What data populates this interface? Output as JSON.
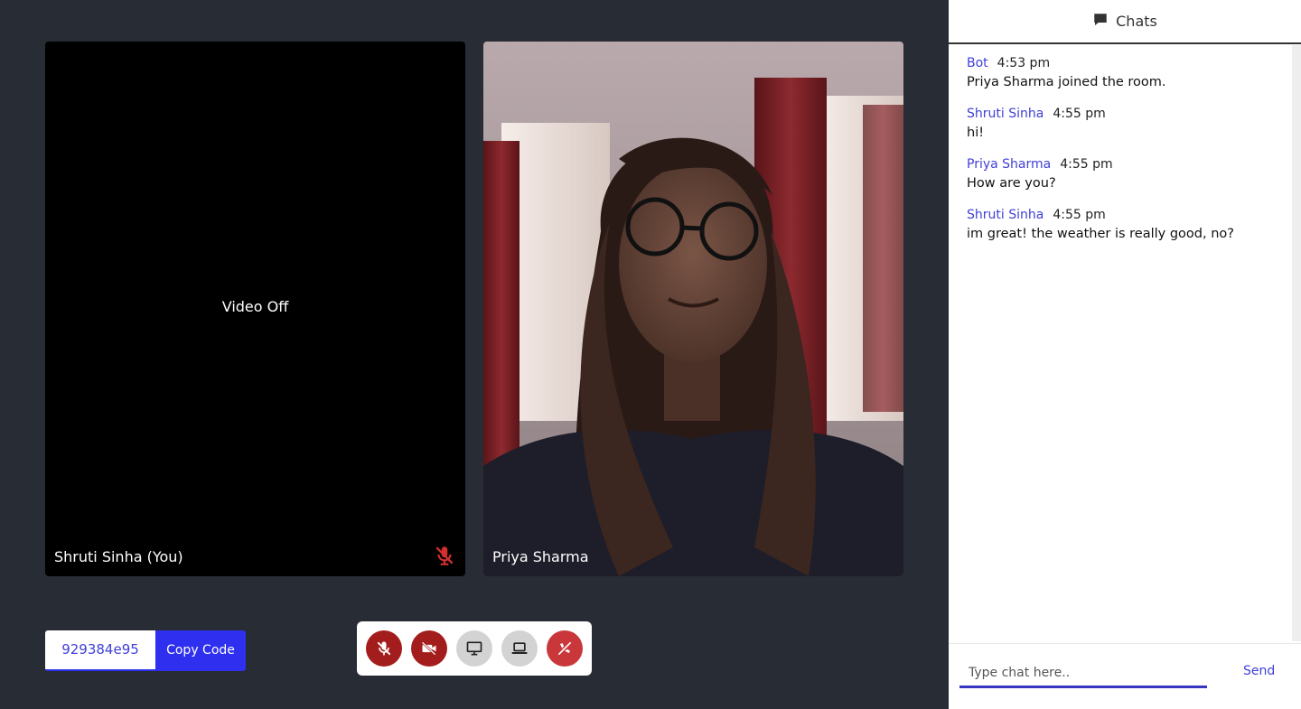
{
  "tiles": {
    "self": {
      "name": "Shruti Sinha (You)",
      "status": "Video Off"
    },
    "remote": {
      "name": "Priya Sharma"
    }
  },
  "room": {
    "code": "929384e95",
    "copy_label": "Copy Code"
  },
  "controls": {
    "buttons": [
      {
        "icon": "mic-off-icon",
        "color": "#a31d1d"
      },
      {
        "icon": "video-off-icon",
        "color": "#a31d1d"
      },
      {
        "icon": "monitor-icon",
        "color": "#d3d3d3"
      },
      {
        "icon": "laptop-icon",
        "color": "#d3d3d3"
      },
      {
        "icon": "end-call-icon",
        "color": "#c9373a"
      }
    ]
  },
  "chat": {
    "title": "Chats",
    "messages": [
      {
        "author": "Bot",
        "time": "4:53 pm",
        "text": "Priya Sharma joined the room."
      },
      {
        "author": "Shruti Sinha",
        "time": "4:55 pm",
        "text": "hi!"
      },
      {
        "author": "Priya Sharma",
        "time": "4:55 pm",
        "text": "How are you?"
      },
      {
        "author": "Shruti Sinha",
        "time": "4:55 pm",
        "text": "im great! the weather is really good, no?"
      }
    ],
    "input_placeholder": "Type chat here..",
    "send_label": "Send"
  },
  "colors": {
    "accent": "#2f2ff0",
    "author": "#3f3fd8",
    "danger": "#a31d1d",
    "background": "#282c34"
  }
}
